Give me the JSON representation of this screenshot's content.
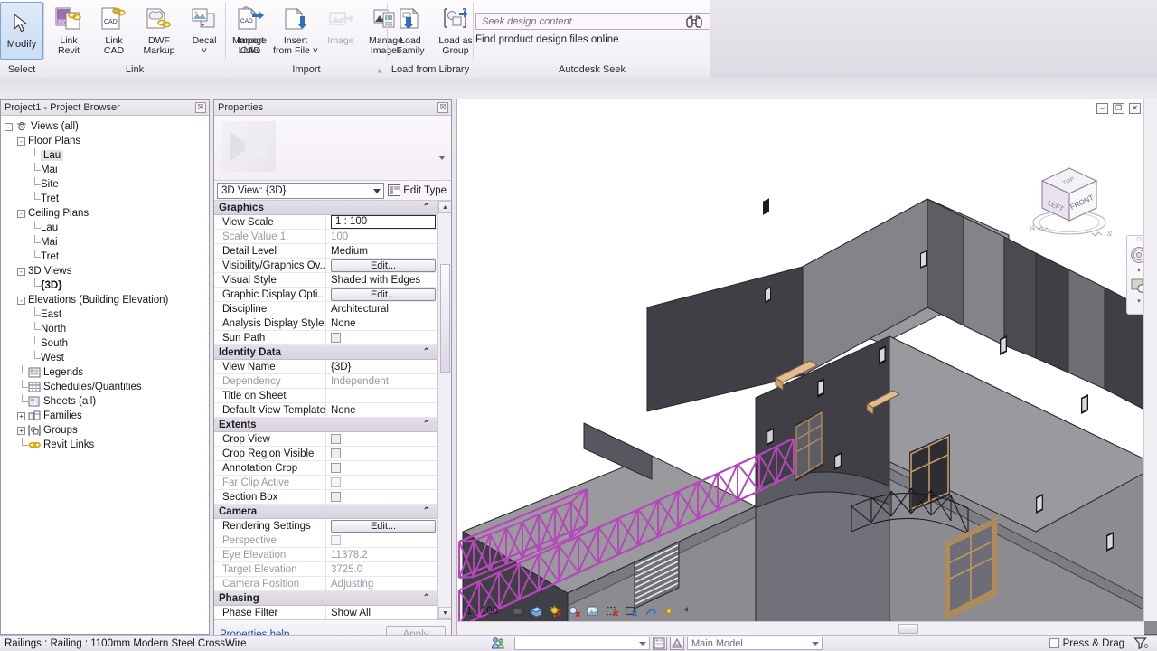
{
  "app": {
    "title": "Autodesk Revit",
    "accent_selection": "#b745bd",
    "accent_link": "#1b4fa8"
  },
  "ribbon": {
    "panels": [
      {
        "id": "select",
        "label": "Select",
        "buttons": [
          {
            "name": "modify",
            "label": "Modify",
            "icon": "arrow-cursor-icon",
            "disabled": false
          }
        ]
      },
      {
        "id": "link",
        "label": "Link",
        "buttons": [
          {
            "name": "link-revit",
            "label": "Link\nRevit",
            "line1": "Link",
            "line2": "Revit",
            "icon": "link-revit-icon",
            "disabled": false
          },
          {
            "name": "link-cad",
            "label": "Link CAD",
            "line1": "Link",
            "line2": "CAD",
            "icon": "link-cad-icon",
            "disabled": false
          },
          {
            "name": "dwf-markup",
            "label": "DWF Markup",
            "line1": "DWF",
            "line2": "Markup",
            "icon": "dwf-markup-icon",
            "disabled": false
          },
          {
            "name": "decal",
            "label": "Decal",
            "line1": "Decal",
            "line2": "˅",
            "icon": "decal-icon",
            "disabled": false
          },
          {
            "name": "manage-links",
            "label": "Manage Links",
            "line1": "Manage",
            "line2": "Links",
            "icon": "manage-links-icon",
            "disabled": false
          }
        ]
      },
      {
        "id": "import",
        "label": "Import",
        "dialog_launcher": "»",
        "buttons": [
          {
            "name": "import-cad",
            "label": "Import CAD",
            "line1": "Import",
            "line2": "CAD",
            "icon": "import-cad-icon",
            "disabled": false
          },
          {
            "name": "insert-from-file",
            "label": "Insert from File",
            "line1": "Insert",
            "line2": "from File ˅",
            "icon": "insert-from-file-icon",
            "disabled": false
          },
          {
            "name": "image",
            "label": "Image",
            "line1": "Image",
            "line2": "",
            "icon": "image-icon",
            "disabled": true
          },
          {
            "name": "manage-images",
            "label": "Manage Images",
            "line1": "Manage",
            "line2": "Images",
            "icon": "manage-images-icon",
            "disabled": false
          }
        ]
      },
      {
        "id": "load-from-library",
        "label": "Load from Library",
        "buttons": [
          {
            "name": "load-family",
            "label": "Load Family",
            "line1": "Load",
            "line2": "Family",
            "icon": "load-family-icon",
            "disabled": false
          },
          {
            "name": "load-as-group",
            "label": "Load as Group",
            "line1": "Load as",
            "line2": "Group",
            "icon": "load-as-group-icon",
            "disabled": false
          }
        ]
      }
    ],
    "seek": {
      "panel_label": "Autodesk Seek",
      "placeholder": "Seek design content",
      "value": "",
      "description": "Find product design files online",
      "search_icon": "binoculars-icon"
    }
  },
  "browser": {
    "title": "Project1 - Project Browser",
    "close_label": "☒",
    "tree": [
      {
        "depth": 0,
        "label": "Views (all)",
        "expander": "-",
        "icon": "views-icon",
        "bold": false,
        "selected": false
      },
      {
        "depth": 1,
        "label": "Floor Plans",
        "expander": "-",
        "icon": "",
        "bold": false,
        "selected": false
      },
      {
        "depth": 2,
        "label": "Lau",
        "expander": "",
        "icon": "",
        "bold": false,
        "selected": true
      },
      {
        "depth": 2,
        "label": "Mai",
        "expander": "",
        "icon": "",
        "bold": false,
        "selected": false
      },
      {
        "depth": 2,
        "label": "Site",
        "expander": "",
        "icon": "",
        "bold": false,
        "selected": false
      },
      {
        "depth": 2,
        "label": "Tret",
        "expander": "",
        "icon": "",
        "bold": false,
        "selected": false
      },
      {
        "depth": 1,
        "label": "Ceiling Plans",
        "expander": "-",
        "icon": "",
        "bold": false,
        "selected": false
      },
      {
        "depth": 2,
        "label": "Lau",
        "expander": "",
        "icon": "",
        "bold": false,
        "selected": false
      },
      {
        "depth": 2,
        "label": "Mai",
        "expander": "",
        "icon": "",
        "bold": false,
        "selected": false
      },
      {
        "depth": 2,
        "label": "Tret",
        "expander": "",
        "icon": "",
        "bold": false,
        "selected": false
      },
      {
        "depth": 1,
        "label": "3D Views",
        "expander": "-",
        "icon": "",
        "bold": false,
        "selected": false
      },
      {
        "depth": 2,
        "label": "{3D}",
        "expander": "",
        "icon": "",
        "bold": true,
        "selected": false
      },
      {
        "depth": 1,
        "label": "Elevations (Building Elevation)",
        "expander": "-",
        "icon": "",
        "bold": false,
        "selected": false
      },
      {
        "depth": 2,
        "label": "East",
        "expander": "",
        "icon": "",
        "bold": false,
        "selected": false
      },
      {
        "depth": 2,
        "label": "North",
        "expander": "",
        "icon": "",
        "bold": false,
        "selected": false
      },
      {
        "depth": 2,
        "label": "South",
        "expander": "",
        "icon": "",
        "bold": false,
        "selected": false
      },
      {
        "depth": 2,
        "label": "West",
        "expander": "",
        "icon": "",
        "bold": false,
        "selected": false
      },
      {
        "depth": 1,
        "label": "Legends",
        "expander": "",
        "icon": "legends-icon",
        "bold": false,
        "selected": false
      },
      {
        "depth": 1,
        "label": "Schedules/Quantities",
        "expander": "",
        "icon": "schedules-icon",
        "bold": false,
        "selected": false
      },
      {
        "depth": 1,
        "label": "Sheets (all)",
        "expander": "",
        "icon": "sheets-icon",
        "bold": false,
        "selected": false
      },
      {
        "depth": 1,
        "label": "Families",
        "expander": "+",
        "icon": "families-icon",
        "bold": false,
        "selected": false
      },
      {
        "depth": 1,
        "label": "Groups",
        "expander": "+",
        "icon": "groups-icon",
        "bold": false,
        "selected": false
      },
      {
        "depth": 1,
        "label": "Revit Links",
        "expander": "",
        "icon": "revit-links-icon",
        "bold": false,
        "selected": false
      }
    ]
  },
  "properties": {
    "title": "Properties",
    "close_label": "☒",
    "type_selector": "3D View: {3D}",
    "edit_type_label": "Edit Type",
    "help_link": "Properties help",
    "apply_label": "Apply",
    "groups": [
      {
        "name": "Graphics",
        "rows": [
          {
            "name": "View Scale",
            "value": "1 : 100",
            "kind": "input",
            "dim": false
          },
          {
            "name": "Scale Value    1:",
            "value": "100",
            "kind": "text",
            "dim": true
          },
          {
            "name": "Detail Level",
            "value": "Medium",
            "kind": "text",
            "dim": false
          },
          {
            "name": "Visibility/Graphics Ov...",
            "value": "Edit...",
            "kind": "button",
            "dim": false
          },
          {
            "name": "Visual Style",
            "value": "Shaded with Edges",
            "kind": "text",
            "dim": false
          },
          {
            "name": "Graphic Display Opti...",
            "value": "Edit...",
            "kind": "button",
            "dim": false
          },
          {
            "name": "Discipline",
            "value": "Architectural",
            "kind": "text",
            "dim": false
          },
          {
            "name": "Analysis Display Style",
            "value": "None",
            "kind": "text",
            "dim": false
          },
          {
            "name": "Sun Path",
            "value": "",
            "kind": "checkbox",
            "dim": false
          }
        ]
      },
      {
        "name": "Identity Data",
        "rows": [
          {
            "name": "View Name",
            "value": "{3D}",
            "kind": "text",
            "dim": false
          },
          {
            "name": "Dependency",
            "value": "Independent",
            "kind": "text",
            "dim": true
          },
          {
            "name": "Title on Sheet",
            "value": "",
            "kind": "text",
            "dim": false
          },
          {
            "name": "Default View Template",
            "value": "None",
            "kind": "text",
            "dim": false
          }
        ]
      },
      {
        "name": "Extents",
        "rows": [
          {
            "name": "Crop View",
            "value": "",
            "kind": "checkbox",
            "dim": false
          },
          {
            "name": "Crop Region Visible",
            "value": "",
            "kind": "checkbox",
            "dim": false
          },
          {
            "name": "Annotation Crop",
            "value": "",
            "kind": "checkbox",
            "dim": false
          },
          {
            "name": "Far Clip Active",
            "value": "",
            "kind": "checkbox",
            "dim": true
          },
          {
            "name": "Section Box",
            "value": "",
            "kind": "checkbox",
            "dim": false
          }
        ]
      },
      {
        "name": "Camera",
        "rows": [
          {
            "name": "Rendering Settings",
            "value": "Edit...",
            "kind": "button",
            "dim": false
          },
          {
            "name": "Perspective",
            "value": "",
            "kind": "checkbox",
            "dim": true
          },
          {
            "name": "Eye Elevation",
            "value": "11378.2",
            "kind": "text",
            "dim": true
          },
          {
            "name": "Target Elevation",
            "value": "3725.0",
            "kind": "text",
            "dim": true
          },
          {
            "name": "Camera Position",
            "value": "Adjusting",
            "kind": "text",
            "dim": true
          }
        ]
      },
      {
        "name": "Phasing",
        "rows": [
          {
            "name": "Phase Filter",
            "value": "Show All",
            "kind": "text",
            "dim": false
          }
        ]
      }
    ]
  },
  "viewport": {
    "scale": "1 : 100",
    "minimize_label": "–",
    "restore_label": "❐",
    "close_label": "✕",
    "viewcube": {
      "top_face": "TOP",
      "left_face": "LEFT",
      "front_face": "FRONT",
      "compass_n": "N",
      "compass_s": "S"
    },
    "navbar": {
      "steering_wheel": "steering-wheel-icon",
      "zoom_tool": "zoom-region-icon"
    },
    "view_control_bar": [
      {
        "name": "scale-label",
        "icon": "",
        "label": "1 : 100"
      },
      {
        "name": "detail-level",
        "icon": "detail-level-icon",
        "label": ""
      },
      {
        "name": "visual-style",
        "icon": "visual-style-icon",
        "label": ""
      },
      {
        "name": "sun-path-off",
        "icon": "sun-path-off-icon",
        "label": ""
      },
      {
        "name": "shadows-off",
        "icon": "shadows-off-icon",
        "label": ""
      },
      {
        "name": "rendering-dialog",
        "icon": "render-dialog-icon",
        "label": ""
      },
      {
        "name": "crop-region-off",
        "icon": "crop-off-icon",
        "label": ""
      },
      {
        "name": "show-crop-region",
        "icon": "show-crop-icon",
        "label": ""
      },
      {
        "name": "unlock-3d-view",
        "icon": "unlock-view-icon",
        "label": ""
      },
      {
        "name": "temporary-hide-isolate",
        "icon": "hide-isolate-icon",
        "label": ""
      },
      {
        "name": "reveal-hidden-elements",
        "icon": "reveal-hidden-icon",
        "label": ""
      }
    ],
    "model": {
      "description": "3D shaded-with-edges architectural model of a multi-storey house",
      "selected_element": "roof terrace railing",
      "selection_color": "#b745bd",
      "wall_light": "#8c8c90",
      "wall_mid": "#6f6f74",
      "wall_dark": "#3c3c41",
      "roof_slab": "#9a9a9e",
      "window_frame": "#c79a63",
      "background": "#ffffff"
    }
  },
  "statusbar": {
    "selection_text": "Railings : Railing : 1100mm Modern Steel CrossWire",
    "workset_value": "",
    "design_option_value": "Main Model",
    "press_drag_label": "Press & Drag",
    "press_drag_checked": false,
    "icons": {
      "worksets": "worksets-icon",
      "design_options": "design-options-icon",
      "exclude_options": "exclude-options-icon",
      "filter": "filter-icon"
    }
  }
}
